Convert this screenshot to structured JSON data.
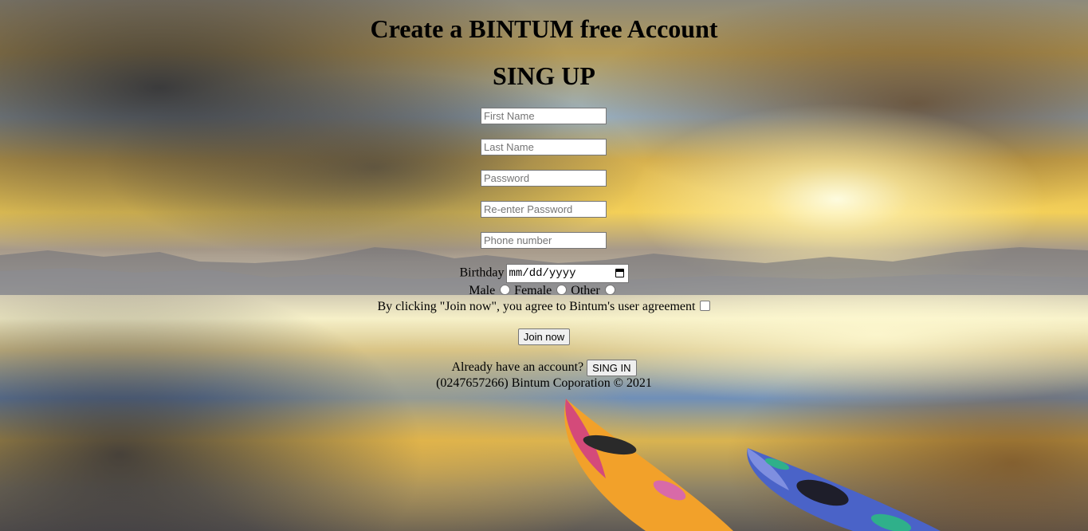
{
  "page": {
    "title": "Create a BINTUM free Account",
    "subtitle": "SING UP"
  },
  "form": {
    "first_name_placeholder": "First Name",
    "last_name_placeholder": "Last Name",
    "password_placeholder": "Password",
    "reenter_password_placeholder": "Re-enter Password",
    "phone_placeholder": "Phone number",
    "birthday_label": "Birthday",
    "birthday_value": "mm/dd/yyyy",
    "gender_options": [
      "Male",
      "Female",
      "Other"
    ],
    "agreement_text": "By clicking \"Join now\", you agree to Bintum's user agreement",
    "join_button": "Join now"
  },
  "footer": {
    "signin_prompt": "Already have an account?",
    "signin_button": "SING IN",
    "copyright": "(0247657266) Bintum Coporation © 2021"
  },
  "icons": {
    "calendar": "calendar-icon"
  }
}
